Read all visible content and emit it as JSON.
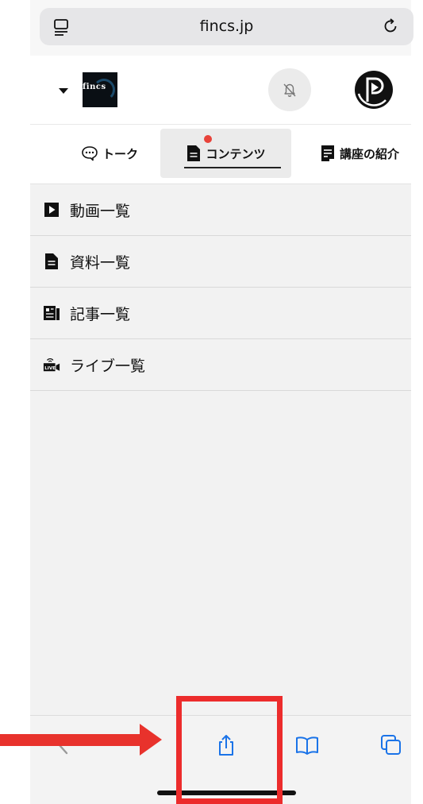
{
  "browser": {
    "url": "fincs.jp",
    "reader_icon": "reader-mode-icon",
    "reload_icon": "reload-icon"
  },
  "header": {
    "logo_text": "fincs",
    "menu_icon": "caret-down-icon",
    "bell_icon": "bell-slash-icon",
    "avatar_icon": "avatar-icon"
  },
  "tabs": [
    {
      "label": "トーク",
      "icon": "chat-bubble-icon"
    },
    {
      "label": "コンテンツ",
      "icon": "document-icon"
    },
    {
      "label": "講座の紹介",
      "icon": "book-icon"
    }
  ],
  "list": [
    {
      "label": "動画一覧",
      "icon": "play-square-icon"
    },
    {
      "label": "資料一覧",
      "icon": "document-icon"
    },
    {
      "label": "記事一覧",
      "icon": "newspaper-icon"
    },
    {
      "label": "ライブ一覧",
      "icon": "live-camera-icon"
    }
  ],
  "toolbar": {
    "back_icon": "back-chevron-icon",
    "share_icon": "share-icon",
    "bookmarks_icon": "book-open-icon",
    "tabs_icon": "tabs-icon"
  },
  "colors": {
    "annotation_red": "#e8322c",
    "notification_dot": "#e8433a"
  }
}
